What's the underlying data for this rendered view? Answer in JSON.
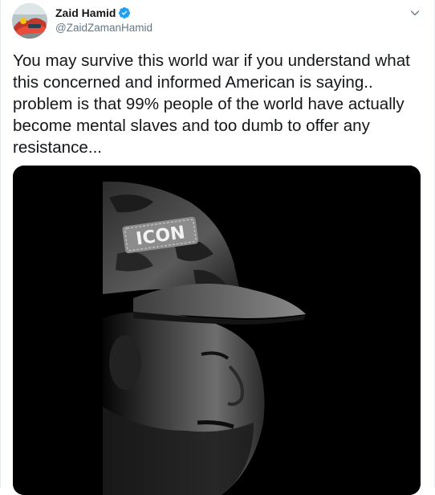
{
  "tweet": {
    "author": {
      "display_name": "Zaid Hamid",
      "handle": "@ZaidZamanHamid",
      "verified": true,
      "avatar_icon": "avatar-image"
    },
    "menu_icon": "chevron-down-icon",
    "text": "You may survive this world war if you understand what this concerned and informed American is saying.. problem is that 99% people of the world have actually become mental slaves and too dumb to offer any resistance...",
    "media": {
      "type": "video-thumbnail",
      "cap_label": "ICON",
      "background": "#000000"
    }
  },
  "colors": {
    "text": "#14171a",
    "secondary": "#657786",
    "verified_blue": "#1da1f2",
    "border": "#e6ecf0"
  }
}
